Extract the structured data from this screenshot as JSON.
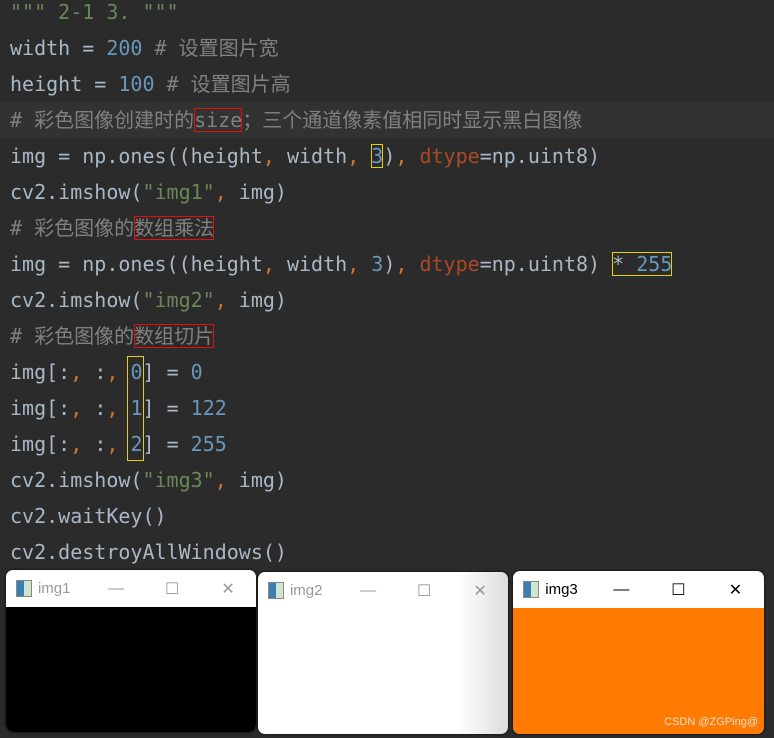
{
  "code_lines": [
    {
      "tokens": [
        [
          "str",
          "\"\"\" 2-1 3. \"\"\""
        ]
      ]
    },
    {
      "tokens": [
        [
          "id",
          "width = "
        ],
        [
          "num",
          "200"
        ],
        [
          "cm",
          " # 设置图片宽"
        ]
      ]
    },
    {
      "tokens": [
        [
          "id",
          "height = "
        ],
        [
          "num",
          "100"
        ],
        [
          "cm",
          " # 设置图片高"
        ]
      ]
    },
    {
      "highlight": true,
      "tokens": [
        [
          "cm",
          "# 彩色图像创建时的"
        ],
        [
          "cm",
          "size",
          "red"
        ],
        [
          "cm",
          "；三个通道像素值相同时显示黑白图像"
        ]
      ]
    },
    {
      "tokens": [
        [
          "id",
          "img = np.ones((height"
        ],
        [
          "kw",
          ", "
        ],
        [
          "id",
          "width"
        ],
        [
          "kw",
          ", "
        ],
        [
          "num",
          "3",
          "yellow"
        ],
        [
          "id",
          ")"
        ],
        [
          "kw",
          ", "
        ],
        [
          "arg",
          "dtype"
        ],
        [
          "id",
          "=np.uint8)"
        ]
      ]
    },
    {
      "tokens": [
        [
          "id",
          "cv2.imshow("
        ],
        [
          "str",
          "\"img1\""
        ],
        [
          "kw",
          ", "
        ],
        [
          "id",
          "img)"
        ]
      ]
    },
    {
      "tokens": [
        [
          "cm",
          "# 彩色图像的"
        ],
        [
          "cm",
          "数组乘法",
          "red"
        ]
      ]
    },
    {
      "tokens": [
        [
          "id",
          "img = np.ones((height"
        ],
        [
          "kw",
          ", "
        ],
        [
          "id",
          "width"
        ],
        [
          "kw",
          ", "
        ],
        [
          "num",
          "3"
        ],
        [
          "id",
          ")"
        ],
        [
          "kw",
          ", "
        ],
        [
          "arg",
          "dtype"
        ],
        [
          "id",
          "=np.uint8) "
        ],
        [
          "mul",
          "* 255",
          "yellow"
        ]
      ]
    },
    {
      "tokens": [
        [
          "id",
          "cv2.imshow("
        ],
        [
          "str",
          "\"img2\""
        ],
        [
          "kw",
          ", "
        ],
        [
          "id",
          "img)"
        ]
      ]
    },
    {
      "tokens": [
        [
          "cm",
          "# 彩色图像的"
        ],
        [
          "cm",
          "数组切片",
          "red"
        ]
      ]
    },
    {
      "tokens": [
        [
          "id",
          "img[:"
        ],
        [
          "kw",
          ", "
        ],
        [
          "id",
          ":"
        ],
        [
          "kw",
          ", "
        ],
        [
          "num",
          "0"
        ],
        [
          "id",
          "] = "
        ],
        [
          "num",
          "0"
        ]
      ]
    },
    {
      "tokens": [
        [
          "id",
          "img[:"
        ],
        [
          "kw",
          ", "
        ],
        [
          "id",
          ":"
        ],
        [
          "kw",
          ", "
        ],
        [
          "num",
          "1"
        ],
        [
          "id",
          "] = "
        ],
        [
          "num",
          "122"
        ]
      ]
    },
    {
      "tokens": [
        [
          "id",
          "img[:"
        ],
        [
          "kw",
          ", "
        ],
        [
          "id",
          ":"
        ],
        [
          "kw",
          ", "
        ],
        [
          "num",
          "2"
        ],
        [
          "id",
          "] = "
        ],
        [
          "num",
          "255"
        ]
      ]
    },
    {
      "tokens": [
        [
          "id",
          "cv2.imshow("
        ],
        [
          "str",
          "\"img3\""
        ],
        [
          "kw",
          ", "
        ],
        [
          "id",
          "img)"
        ]
      ]
    },
    {
      "tokens": [
        [
          "id",
          "cv2.waitKey()"
        ]
      ]
    },
    {
      "tokens": [
        [
          "id",
          "cv2.destroyAllWindows()"
        ]
      ]
    }
  ],
  "windows": [
    {
      "title": "img1",
      "minimize": "—",
      "maximize": "☐",
      "close": "✕",
      "fill": "#000000",
      "active": false
    },
    {
      "title": "img2",
      "minimize": "—",
      "maximize": "☐",
      "close": "✕",
      "fill": "#ffffff",
      "active": false
    },
    {
      "title": "img3",
      "minimize": "—",
      "maximize": "☐",
      "close": "✕",
      "fill": "#ff7a00",
      "active": true
    }
  ],
  "watermark": "CSDN @ZGPing@"
}
